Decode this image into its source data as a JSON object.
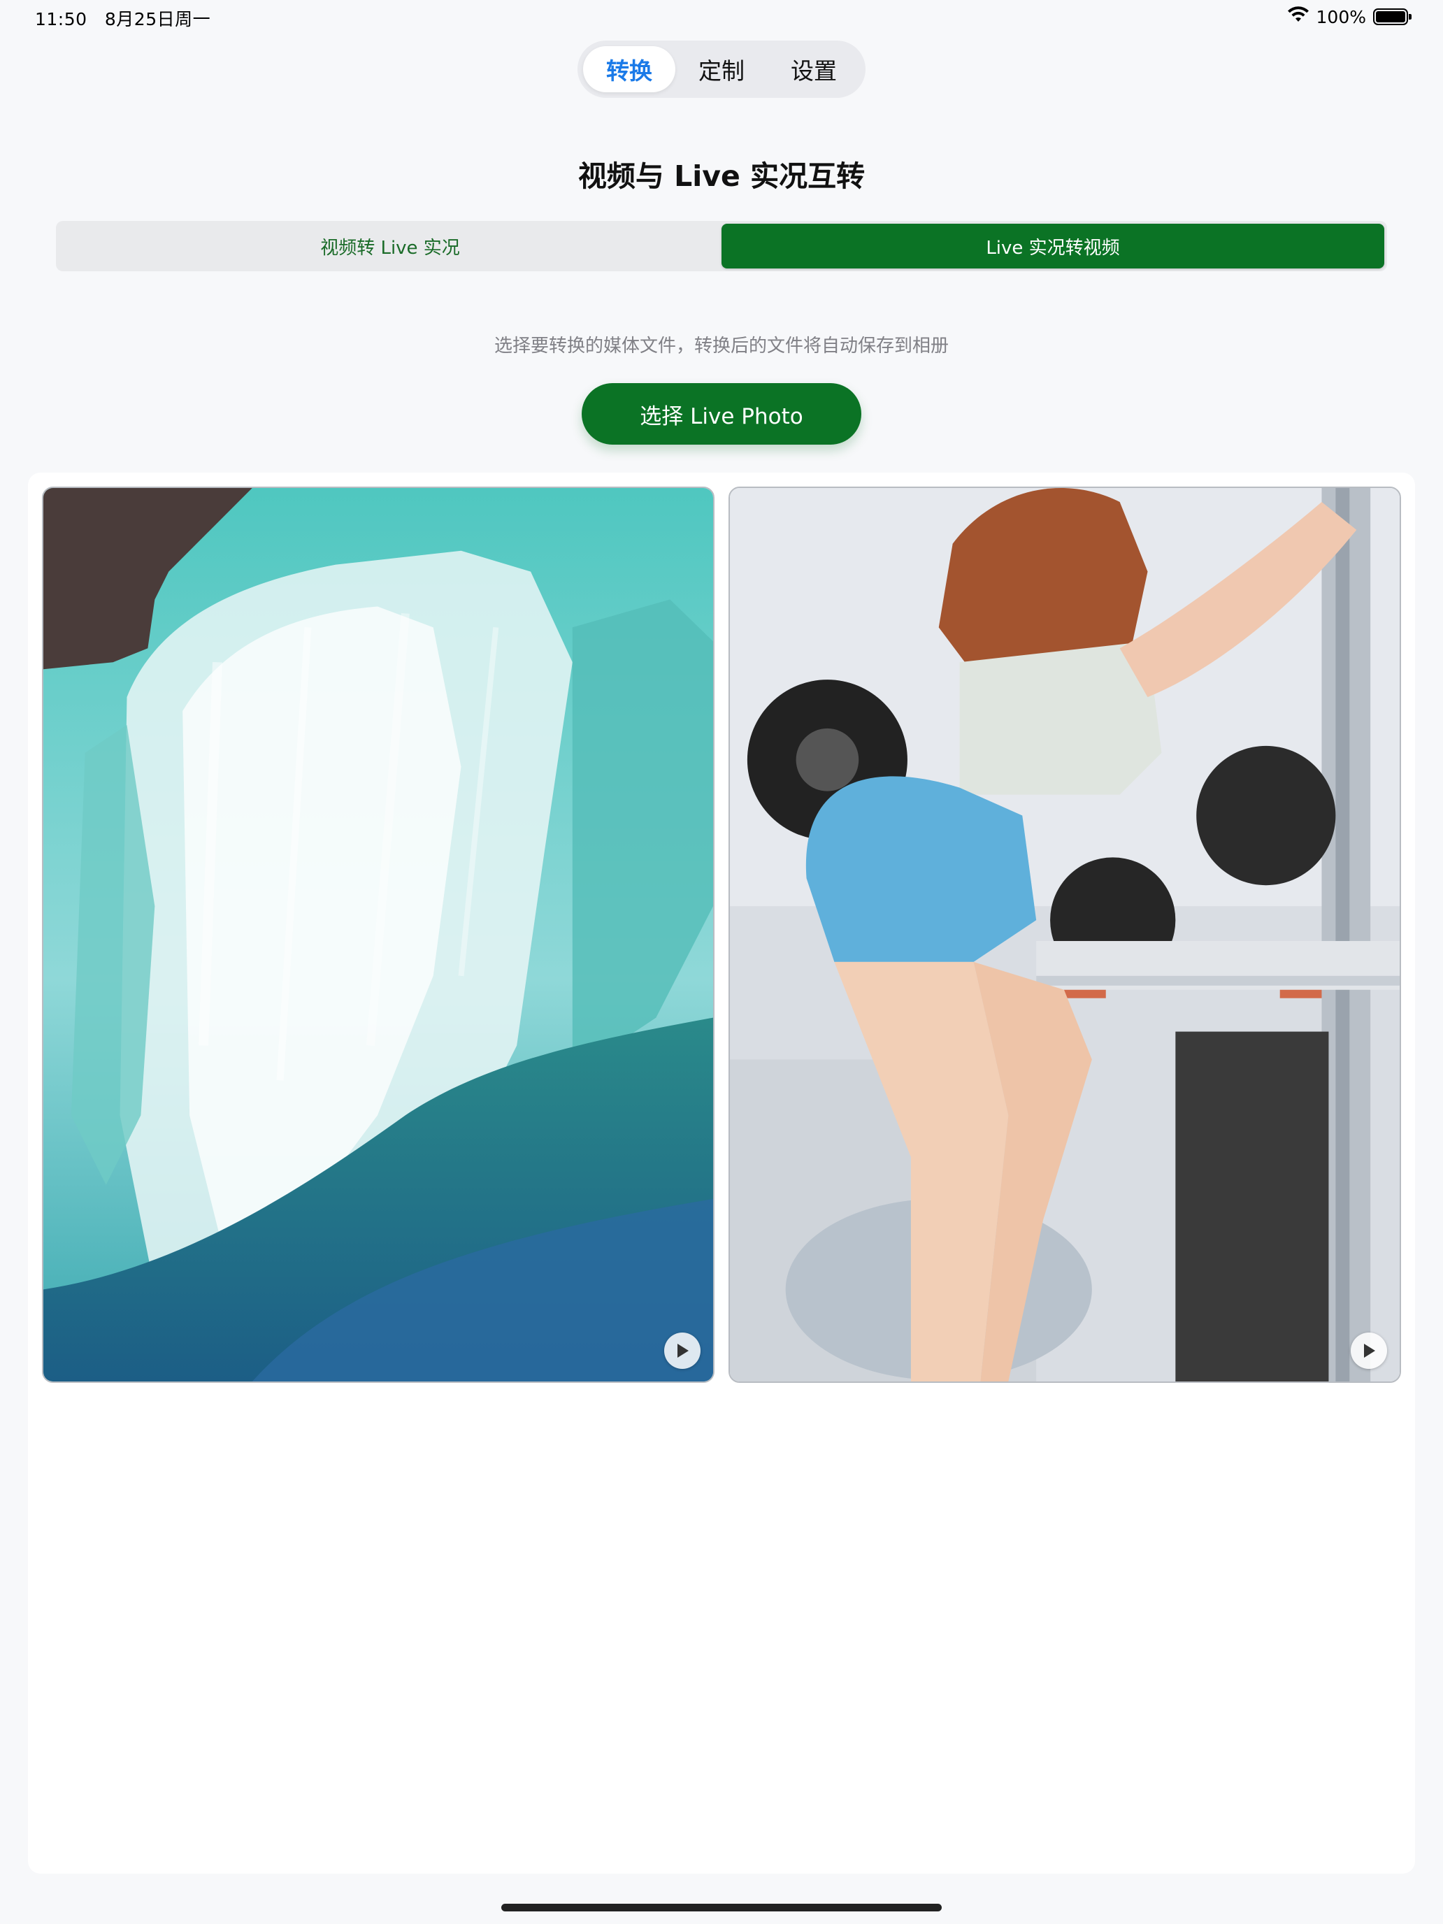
{
  "status": {
    "time": "11:50",
    "date": "8月25日周一",
    "battery_percent": "100%",
    "battery_level": 1.0
  },
  "top_tabs": [
    {
      "label": "转换",
      "active": true
    },
    {
      "label": "定制",
      "active": false
    },
    {
      "label": "设置",
      "active": false
    }
  ],
  "title": "视频与 Live 实况互转",
  "mode_tabs": [
    {
      "label": "视频转 Live 实况",
      "active": false
    },
    {
      "label": "Live 实况转视频",
      "active": true
    }
  ],
  "hint": "选择要转换的媒体文件，转换后的文件将自动保存到相册",
  "pick_button": "选择 Live Photo",
  "media": [
    {
      "subject": "waterfall",
      "icon": "play-icon"
    },
    {
      "subject": "gym-squat",
      "icon": "play-icon"
    }
  ],
  "colors": {
    "accent_green": "#0b7325",
    "tab_blue": "#1a7ae8",
    "background": "#f7f8fa"
  }
}
